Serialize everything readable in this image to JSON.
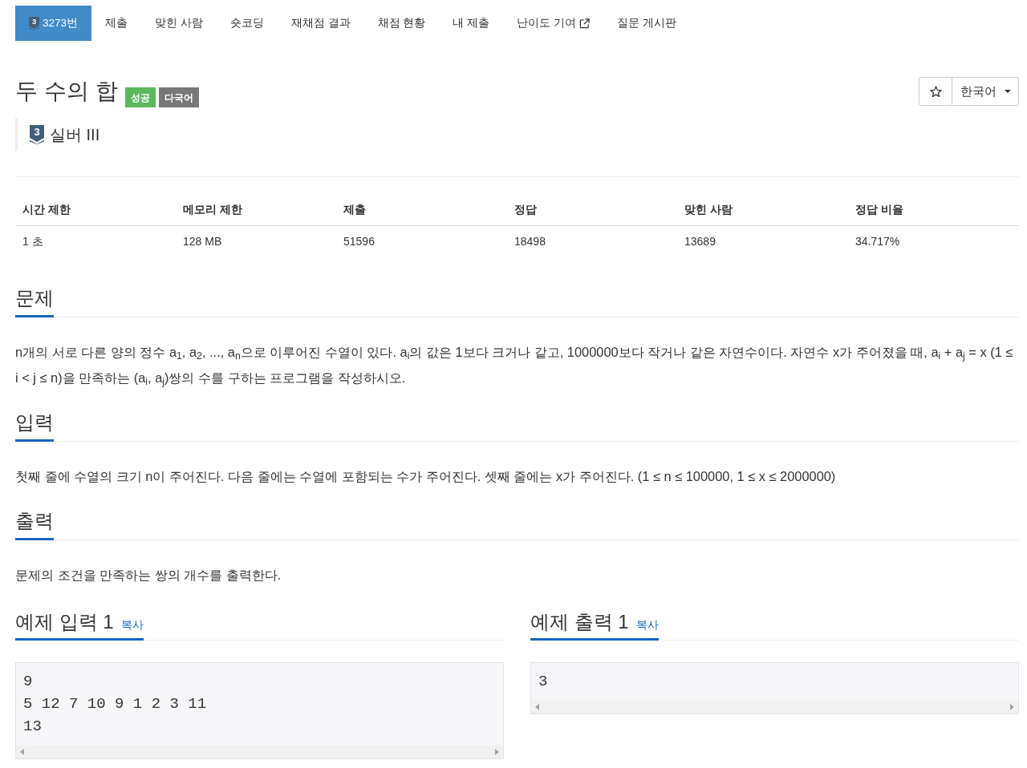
{
  "nav": {
    "tabs": [
      {
        "kind": "problem",
        "badge": "3",
        "label": "3273번",
        "selected": true
      },
      {
        "kind": "link",
        "label": "제출",
        "selected": false
      },
      {
        "kind": "link",
        "label": "맞힌 사람",
        "selected": false
      },
      {
        "kind": "link",
        "label": "숏코딩",
        "selected": false
      },
      {
        "kind": "link",
        "label": "재채점 결과",
        "selected": false
      },
      {
        "kind": "link",
        "label": "채점 현황",
        "selected": false
      },
      {
        "kind": "link",
        "label": "내 제출",
        "selected": false
      },
      {
        "kind": "external",
        "label": "난이도 기여",
        "selected": false
      },
      {
        "kind": "link",
        "label": "질문 게시판",
        "selected": false
      }
    ]
  },
  "problem": {
    "title": "두 수의 합",
    "labels": [
      {
        "text": "성공",
        "color": "#5cb85c"
      },
      {
        "text": "다국어",
        "color": "#777777"
      }
    ],
    "tier": {
      "badge": "3",
      "name": "실버 III"
    },
    "starred": false,
    "language": "한국어"
  },
  "stats": {
    "columns": [
      "시간 제한",
      "메모리 제한",
      "제출",
      "정답",
      "맞힌 사람",
      "정답 비율"
    ],
    "rows": [
      [
        "1 초",
        "128 MB",
        "51596",
        "18498",
        "13689",
        "34.717%"
      ]
    ]
  },
  "sections": [
    {
      "heading": "문제",
      "body": "n개의 서로 다른 양의 정수 a$_{1}$, a$_{2}$, ..., a$_{n}$으로 이루어진 수열이 있다. a$_{i}$의 값은 1보다 크거나 같고, 1000000보다 작거나 같은 자연수이다. 자연수 x가 주어졌을 때, a$_{i}$ + a$_{j}$ = x (1 ≤ i < j ≤ n)을 만족하는 (a$_{i}$, a$_{j}$)쌍의 수를 구하는 프로그램을 작성하시오."
    },
    {
      "heading": "입력",
      "body": "첫째 줄에 수열의 크기 n이 주어진다. 다음 줄에는 수열에 포함되는 수가 주어진다. 셋째 줄에는 x가 주어진다. (1 ≤ n ≤ 100000, 1 ≤ x ≤ 2000000)"
    },
    {
      "heading": "출력",
      "body": "문제의 조건을 만족하는 쌍의 개수를 출력한다."
    }
  ],
  "samples": [
    {
      "heading": "예제 입력 1",
      "copy": "복사",
      "lines": [
        "9",
        "5 12 7 10 9 1 2 3 11",
        "13"
      ]
    },
    {
      "heading": "예제 출력 1",
      "copy": "복사",
      "lines": [
        "3"
      ]
    }
  ]
}
